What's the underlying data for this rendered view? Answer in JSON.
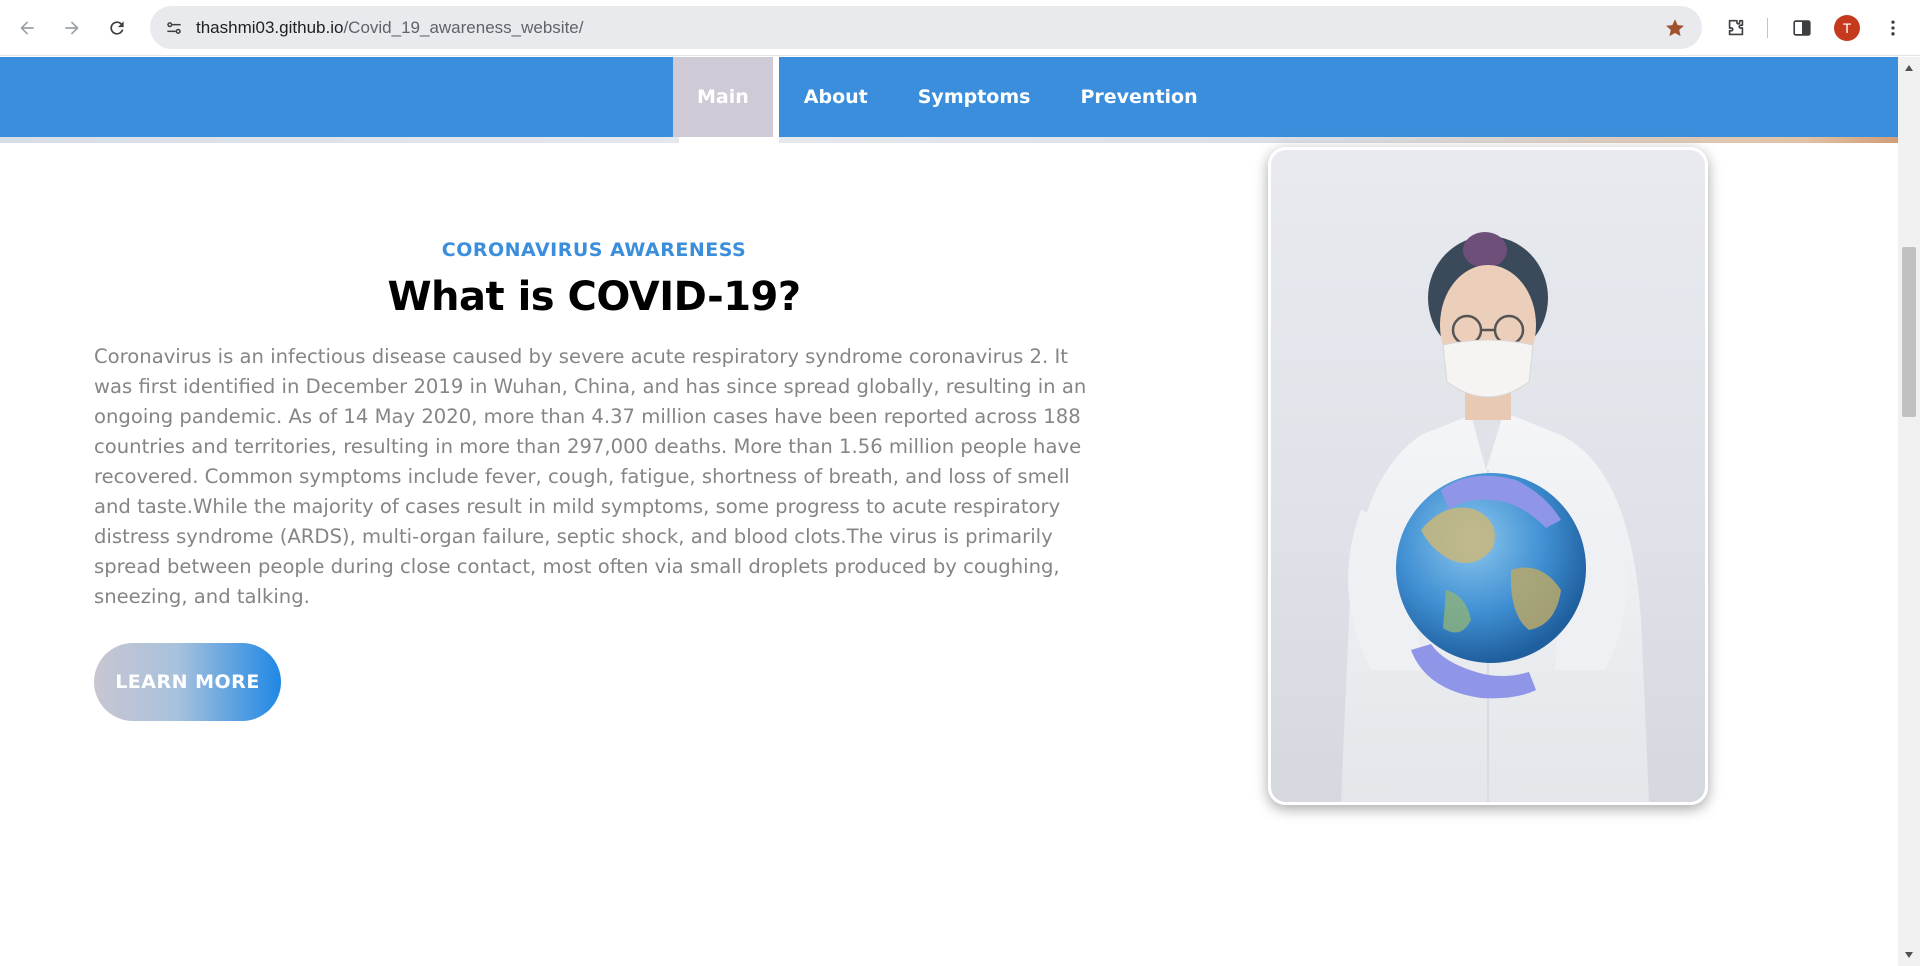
{
  "browser": {
    "url_host": "thashmi03.github.io",
    "url_path": "/Covid_19_awareness_website/",
    "profile_initial": "T",
    "bookmark_star_color": "#c5591f"
  },
  "nav": {
    "items": [
      {
        "label": "Main",
        "active": true
      },
      {
        "label": "About",
        "active": false
      },
      {
        "label": "Symptoms",
        "active": false
      },
      {
        "label": "Prevention",
        "active": false
      }
    ],
    "background_color": "#3a8edb",
    "active_color": "#d0c9d6"
  },
  "content": {
    "tag": "CORONAVIRUS AWARENESS",
    "heading": "What is COVID-19?",
    "body": "Coronavirus is an infectious disease caused by severe acute respiratory syndrome coronavirus 2. It was first identified in December 2019 in Wuhan, China, and has since spread globally, resulting in an ongoing pandemic. As of 14 May 2020, more than 4.37 million cases have been reported across 188 countries and territories, resulting in more than 297,000 deaths. More than 1.56 million people have recovered. Common symptoms include fever, cough, fatigue, shortness of breath, and loss of smell and taste.While the majority of cases result in mild symptoms, some progress to acute respiratory distress syndrome (ARDS), multi-organ failure, septic shock, and blood clots.The virus is primarily spread between people during close contact, most often via small droplets produced by coughing, sneezing, and talking.",
    "button_label": "LEARN MORE"
  },
  "icons": {
    "back": "back-arrow-icon",
    "forward": "forward-arrow-icon",
    "reload": "reload-icon",
    "site_info": "site-settings-icon",
    "bookmark": "star-icon",
    "extensions": "puzzle-icon",
    "side_panel": "side-panel-icon",
    "menu": "more-vert-icon"
  }
}
